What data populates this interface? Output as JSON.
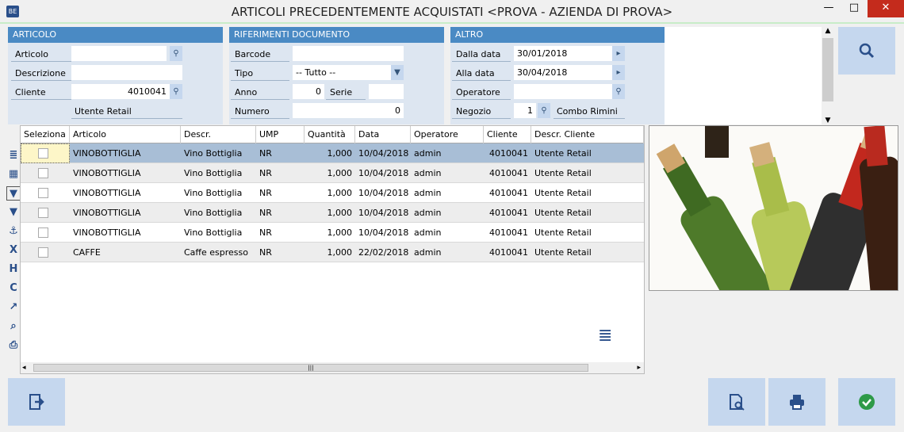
{
  "window": {
    "title": "ARTICOLI PRECEDENTEMENTE ACQUISTATI <PROVA - AZIENDA DI PROVA>",
    "app_icon": "BE",
    "minimize": "—",
    "maximize": "□",
    "close": "✕"
  },
  "articolo": {
    "header": "ARTICOLO",
    "articolo_label": "Articolo",
    "articolo_value": "",
    "descrizione_label": "Descrizione",
    "descrizione_value": "",
    "cliente_label": "Cliente",
    "cliente_value": "4010041",
    "cliente_name": "Utente Retail"
  },
  "riferimenti": {
    "header": "RIFERIMENTI DOCUMENTO",
    "barcode_label": "Barcode",
    "barcode_value": "",
    "tipo_label": "Tipo",
    "tipo_value": "-- Tutto --",
    "anno_label": "Anno",
    "anno_value": "0",
    "serie_label": "Serie",
    "serie_value": "",
    "numero_label": "Numero",
    "numero_value": "0"
  },
  "altro": {
    "header": "ALTRO",
    "dalla_label": "Dalla data",
    "dalla_value": "30/01/2018",
    "alla_label": "Alla data",
    "alla_value": "30/04/2018",
    "operatore_label": "Operatore",
    "operatore_value": "",
    "negozio_label": "Negozio",
    "negozio_value": "1",
    "negozio_name": "Combo Rimini"
  },
  "grid": {
    "columns": [
      "Seleziona",
      "Articolo",
      "Descr.",
      "UMP",
      "Quantità",
      "Data",
      "Operatore",
      "Cliente",
      "Descr. Cliente"
    ],
    "rows": [
      [
        "",
        "VINOBOTTIGLIA",
        "Vino Bottiglia",
        "NR",
        "1,000",
        "10/04/2018",
        "admin",
        "4010041",
        "Utente Retail"
      ],
      [
        "",
        "VINOBOTTIGLIA",
        "Vino Bottiglia",
        "NR",
        "1,000",
        "10/04/2018",
        "admin",
        "4010041",
        "Utente Retail"
      ],
      [
        "",
        "VINOBOTTIGLIA",
        "Vino Bottiglia",
        "NR",
        "1,000",
        "10/04/2018",
        "admin",
        "4010041",
        "Utente Retail"
      ],
      [
        "",
        "VINOBOTTIGLIA",
        "Vino Bottiglia",
        "NR",
        "1,000",
        "10/04/2018",
        "admin",
        "4010041",
        "Utente Retail"
      ],
      [
        "",
        "VINOBOTTIGLIA",
        "Vino Bottiglia",
        "NR",
        "1,000",
        "10/04/2018",
        "admin",
        "4010041",
        "Utente Retail"
      ],
      [
        "",
        "CAFFE",
        "Caffe espresso",
        "NR",
        "1,000",
        "22/02/2018",
        "admin",
        "4010041",
        "Utente Retail"
      ]
    ]
  },
  "side_icons": [
    "list-icon",
    "table-icon",
    "filter-icon",
    "filter-text-icon",
    "anchor-icon",
    "remove-column-icon",
    "hide-column-icon",
    "column-icon",
    "chart-icon",
    "preview-icon",
    "print-icon"
  ],
  "side_glyphs": [
    "≣",
    "▦",
    "▼",
    "▼",
    "⚓",
    "X",
    "H",
    "C",
    "↗",
    "⌕",
    "⎙"
  ]
}
